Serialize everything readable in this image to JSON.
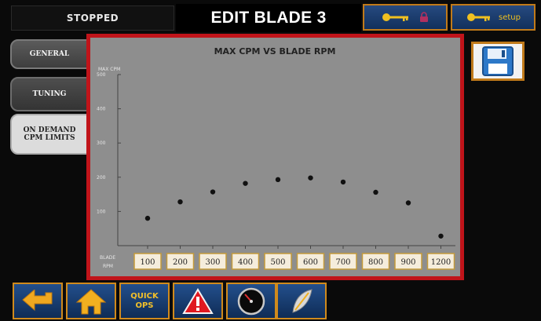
{
  "header": {
    "status": "STOPPED",
    "title": "EDIT BLADE 3",
    "lock_button": {
      "icon": "key-icon",
      "lock_icon": "lock-icon"
    },
    "setup_button": {
      "icon": "key-icon",
      "label": "setup"
    }
  },
  "tabs": [
    {
      "label": "GENERAL"
    },
    {
      "label": "TUNING"
    },
    {
      "label": "ON DEMAND\nCPM LIMITS",
      "selected": true
    }
  ],
  "save_button": {
    "icon": "floppy-disk-icon"
  },
  "chart_data": {
    "type": "scatter",
    "title": "MAX CPM VS BLADE RPM",
    "ylabel": "MAX CPM",
    "xlabel": "BLADE RPM",
    "ylim": [
      0,
      500
    ],
    "yticks": [
      100,
      200,
      300,
      400,
      500
    ],
    "categories": [
      "100",
      "200",
      "300",
      "400",
      "500",
      "600",
      "700",
      "800",
      "900",
      "1200"
    ],
    "values": [
      80,
      128,
      157,
      182,
      193,
      198,
      186,
      156,
      125,
      28
    ],
    "colors": {
      "background": "#8e8e8e",
      "border": "#c0141a",
      "point": "#111111",
      "label_box": "#f5eddc"
    }
  },
  "bottom_nav": {
    "back": {
      "icon": "back-arrow-icon"
    },
    "home": {
      "icon": "home-icon"
    },
    "quick_ops": {
      "line1": "QUICK",
      "line2": "OPS"
    },
    "alarm": {
      "icon": "alarm-triangle-icon"
    },
    "gauge": {
      "icon": "gauge-icon"
    },
    "blade": {
      "icon": "blade-icon"
    }
  },
  "colors": {
    "accent_border": "#d08a1c",
    "button_blue": "#1d4680",
    "text_yellow": "#f2c02a"
  }
}
